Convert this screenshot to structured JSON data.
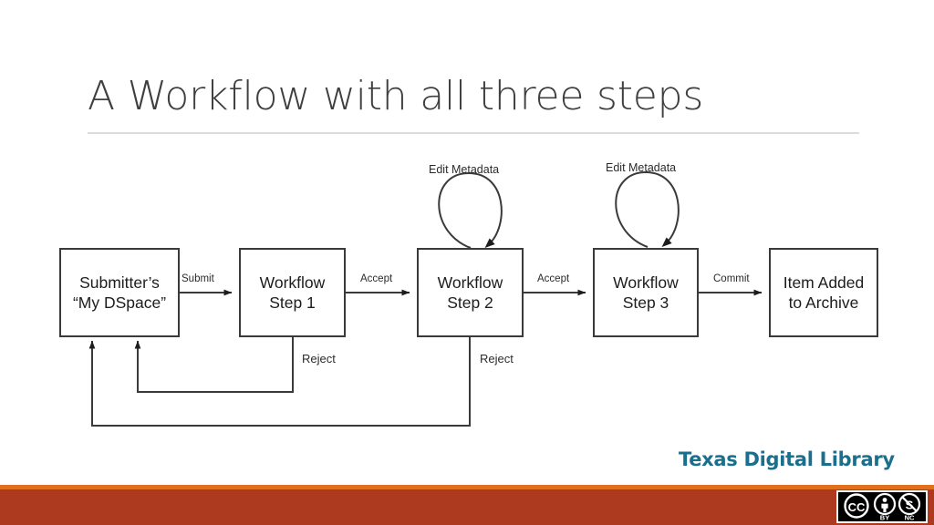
{
  "slide": {
    "title": "A Workflow with all three steps",
    "background_color": "#ffffff",
    "title_color": "#3f3f3f",
    "rule_color": "#dcdcdc"
  },
  "diagram": {
    "type": "flowchart",
    "nodes": [
      {
        "id": "submitter",
        "line1": "Submitter’s",
        "line2": "“My DSpace”"
      },
      {
        "id": "step1",
        "line1": "Workflow",
        "line2": "Step 1"
      },
      {
        "id": "step2",
        "line1": "Workflow",
        "line2": "Step 2"
      },
      {
        "id": "step3",
        "line1": "Workflow",
        "line2": "Step 3"
      },
      {
        "id": "archive",
        "line1": "Item Added",
        "line2": "to Archive"
      }
    ],
    "edges": [
      {
        "id": "submit",
        "label": "Submit",
        "from": "submitter",
        "to": "step1"
      },
      {
        "id": "accept1",
        "label": "Accept",
        "from": "step1",
        "to": "step2"
      },
      {
        "id": "accept2",
        "label": "Accept",
        "from": "step2",
        "to": "step3"
      },
      {
        "id": "commit",
        "label": "Commit",
        "from": "step3",
        "to": "archive"
      },
      {
        "id": "reject1",
        "label": "Reject",
        "from": "step1",
        "to": "submitter"
      },
      {
        "id": "reject2",
        "label": "Reject",
        "from": "step2",
        "to": "submitter"
      }
    ],
    "self_loops": [
      {
        "id": "loop-step2",
        "label": "Edit Metadata",
        "on": "step2"
      },
      {
        "id": "loop-step3",
        "label": "Edit Metadata",
        "on": "step3"
      }
    ],
    "stroke_color": "#3a3a3a",
    "text_color": "#1d1d1d"
  },
  "logo": {
    "wordmark": "Texas Digital Library",
    "star_color": "#1a8392",
    "text_color": "#1a6f8c"
  },
  "footer": {
    "accent_color": "#e0701d",
    "bar_color": "#ad3a1f",
    "license": {
      "name": "cc-by-nc-badge",
      "cc_label": "CC",
      "by_label": "BY",
      "nc_label": "NC"
    }
  }
}
